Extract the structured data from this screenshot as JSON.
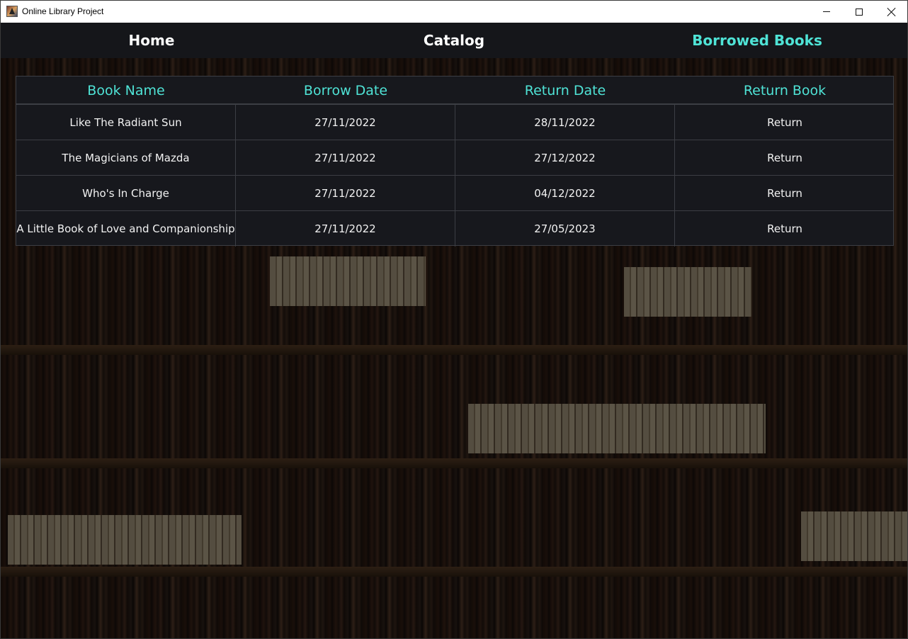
{
  "window": {
    "title": "Online Library Project"
  },
  "nav": {
    "items": [
      {
        "label": "Home",
        "active": false
      },
      {
        "label": "Catalog",
        "active": false
      },
      {
        "label": "Borrowed Books",
        "active": true
      }
    ]
  },
  "table": {
    "headers": [
      "Book Name",
      "Borrow Date",
      "Return Date",
      "Return Book"
    ],
    "rows": [
      {
        "book": "Like The Radiant Sun",
        "borrow": "27/11/2022",
        "return_date": "28/11/2022",
        "action": "Return"
      },
      {
        "book": "The Magicians of Mazda",
        "borrow": "27/11/2022",
        "return_date": "27/12/2022",
        "action": "Return"
      },
      {
        "book": "Who's In Charge",
        "borrow": "27/11/2022",
        "return_date": "04/12/2022",
        "action": "Return"
      },
      {
        "book": "A Little Book of Love and Companionship",
        "borrow": "27/11/2022",
        "return_date": "27/05/2023",
        "action": "Return"
      }
    ]
  },
  "colors": {
    "accent": "#4fe3d6",
    "navbar_bg": "#15161a",
    "table_bg": "#17181d",
    "text": "#f2f2f2"
  },
  "icons": {
    "app": "library-app-icon",
    "minimize": "minimize-icon",
    "maximize": "maximize-icon",
    "close": "close-icon"
  }
}
